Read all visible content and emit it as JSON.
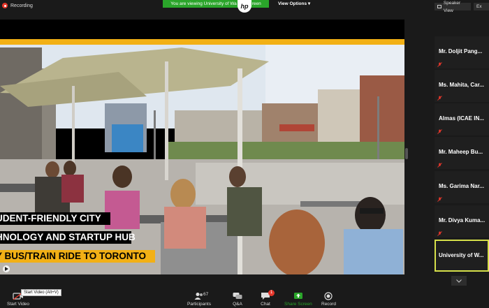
{
  "topbar": {
    "recording_label": "Recording",
    "viewing_banner": "You are viewing University of Wa",
    "viewing_banner_tail": "reen",
    "logo_text": "hp",
    "view_options_label": "View Options",
    "speaker_view_label": "Speaker View",
    "exit_label": "Ex"
  },
  "video": {
    "captions": [
      "UDENT-FRIENDLY CITY",
      "HNOLOGY AND STARTUP HUB",
      "Y BUS/TRAIN RIDE TO TORONTO"
    ]
  },
  "participants": [
    {
      "name": "Mr. Doljit Pang..."
    },
    {
      "name": "Ms. Mahita, Car..."
    },
    {
      "name": "Almas  (ICAE IN..."
    },
    {
      "name": "Mr. Maheep Bu..."
    },
    {
      "name": "Ms. Garima Nar..."
    },
    {
      "name": "Mr. Divya Kuma..."
    },
    {
      "name": "University of W..."
    }
  ],
  "toolbar": {
    "start_video_label": "Start Video",
    "start_video_tooltip": "Start Video (Alt+V)",
    "participants_label": "Participants",
    "participants_count": "67",
    "qa_label": "Q&A",
    "chat_label": "Chat",
    "chat_badge": "1",
    "share_screen_label": "Share Screen",
    "record_label": "Record"
  },
  "colors": {
    "accent_green": "#2aa52a",
    "record_red": "#e5372b",
    "caption_yellow": "#f2b015",
    "active_border": "#d6e04a"
  }
}
